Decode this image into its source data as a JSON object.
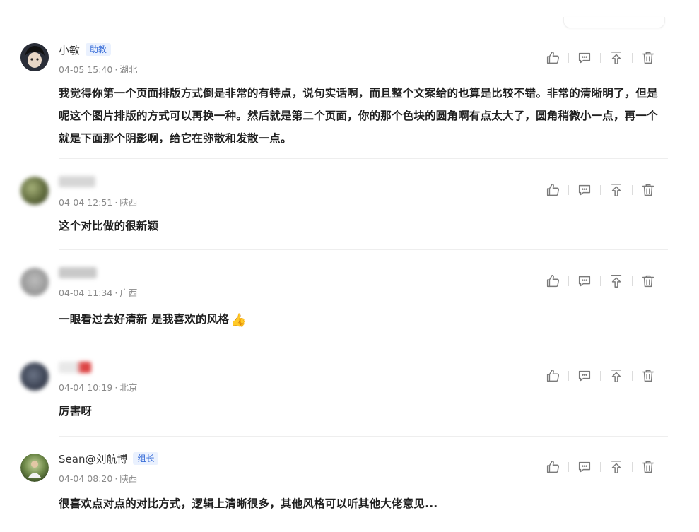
{
  "comments": [
    {
      "name": "小敏",
      "badge": "助教",
      "time": "04-05 15:40",
      "location": "湖北",
      "text": "我觉得你第一个页面排版方式倒是非常的有特点，说句实话啊，而且整个文案给的也算是比较不错。非常的清晰明了，但是呢这个图片排版的方式可以再换一种。然后就是第二个页面，你的那个色块的圆角啊有点太大了，圆角稍微小一点，再一个就是下面那个阴影啊，给它在弥散和发散一点。"
    },
    {
      "name": "",
      "badge": "",
      "time": "04-04 12:51",
      "location": "陕西",
      "text": "这个对比做的很新颖"
    },
    {
      "name": "",
      "badge": "",
      "time": "04-04 11:34",
      "location": "广西",
      "text": "一眼看过去好清新 是我喜欢的风格"
    },
    {
      "name": "",
      "badge": "",
      "time": "04-04 10:19",
      "location": "北京",
      "text": "厉害呀"
    },
    {
      "name": "Sean@刘航博",
      "badge": "组长",
      "time": "04-04 08:20",
      "location": "陕西",
      "text": "很喜欢点对点的对比方式，逻辑上清晰很多，其他风格可以听其他大佬意见..."
    }
  ],
  "meta_separator": "·",
  "emoji_thumb": "👍",
  "icons": [
    "thumbs-up-icon",
    "comment-icon",
    "pin-to-top-icon",
    "trash-icon"
  ],
  "colors": {
    "badge_text": "#3b6fd8",
    "badge_bg": "#eaf1fe",
    "meta": "#8a8a8a",
    "icon": "#7a7a7a"
  }
}
